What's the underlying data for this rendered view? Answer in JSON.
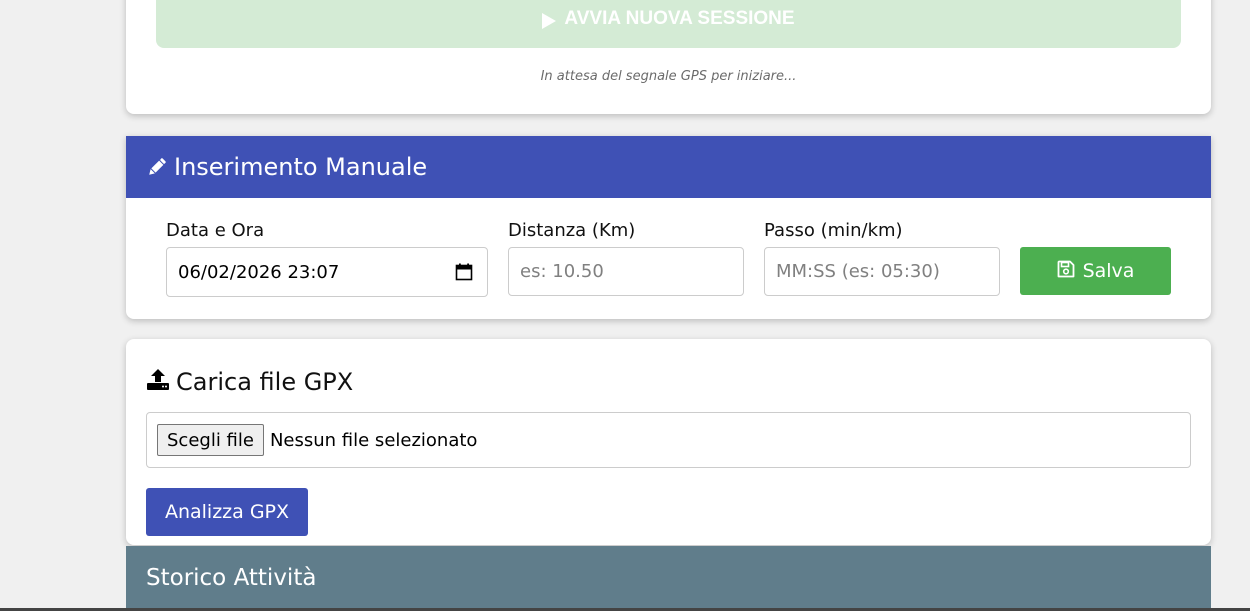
{
  "session": {
    "start_label": "AVVIA NUOVA SESSIONE",
    "gps_status": "In attesa del segnale GPS per iniziare..."
  },
  "manual": {
    "title": "Inserimento Manuale",
    "date_label": "Data e Ora",
    "date_value": "06/02/2026 23:07",
    "distance_label": "Distanza (Km)",
    "distance_placeholder": "es: 10.50",
    "pace_label": "Passo (min/km)",
    "pace_placeholder": "MM:SS (es: 05:30)",
    "save_label": "Salva"
  },
  "gpx": {
    "title": "Carica file GPX",
    "choose_label": "Scegli file",
    "no_file_label": "Nessun file selezionato",
    "analyze_label": "Analizza GPX"
  },
  "history": {
    "title": "Storico Attività"
  },
  "colors": {
    "primary": "#3f51b5",
    "success": "#4caf50",
    "success_disabled": "#d4ebd5",
    "history_header": "#607d8b"
  }
}
